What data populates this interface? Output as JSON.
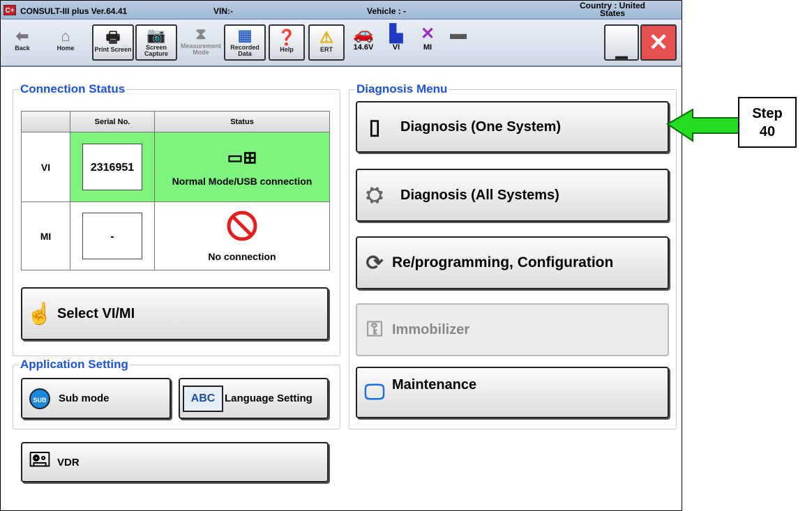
{
  "titlebar": {
    "logo": "C+",
    "app_title": "CONSULT-III plus  Ver.64.41",
    "vin": "VIN:-",
    "vehicle": "Vehicle : -",
    "country": "Country : United States"
  },
  "toolbar": {
    "back": "Back",
    "home": "Home",
    "print_screen": "Print Screen",
    "screen_capture": "Screen Capture",
    "measurement_mode": "Measurement Mode",
    "recorded_data": "Recorded Data",
    "help": "Help",
    "ert": "ERT",
    "voltage": "14.6V",
    "vi": "VI",
    "mi": "MI"
  },
  "connection_status": {
    "title": "Connection Status",
    "col_serial": "Serial No.",
    "col_status": "Status",
    "rows": [
      {
        "label": "VI",
        "serial": "2316951",
        "status": "Normal Mode/USB connection"
      },
      {
        "label": "MI",
        "serial": "-",
        "status": "No connection"
      }
    ],
    "select_button": "Select VI/MI"
  },
  "application_setting": {
    "title": "Application Setting",
    "sub_mode": "Sub mode",
    "sub_icon": "SUB",
    "language_setting": "Language Setting",
    "abc_icon": "ABC"
  },
  "vdr_button": "VDR",
  "diagnosis_menu": {
    "title": "Diagnosis Menu",
    "one_system": "Diagnosis (One System)",
    "all_systems": "Diagnosis (All Systems)",
    "reprogramming": "Re/programming, Configuration",
    "immobilizer": "Immobilizer",
    "maintenance": "Maintenance"
  },
  "callout": {
    "line1": "Step",
    "line2": "40",
    "color": "#22dd22"
  }
}
